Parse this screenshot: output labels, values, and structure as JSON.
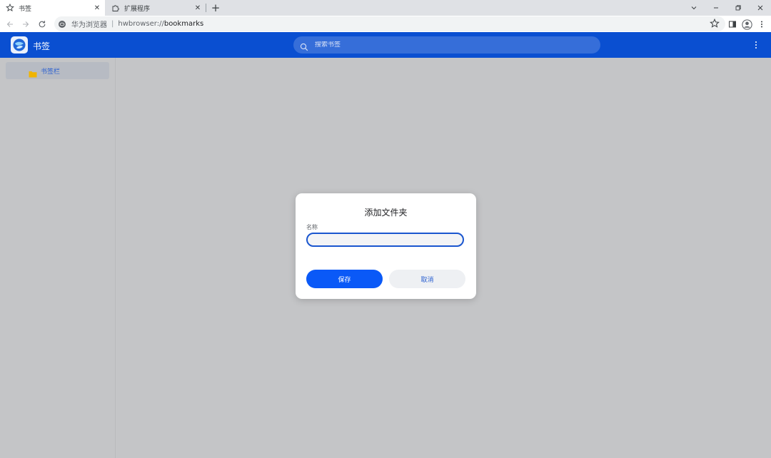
{
  "tabs": [
    {
      "title": "书签",
      "icon": "bookmark-star-icon",
      "active": true
    },
    {
      "title": "扩展程序",
      "icon": "puzzle-icon",
      "active": false
    }
  ],
  "omnibox": {
    "site_name": "华为浏览器",
    "url_scheme": "hwbrowser://",
    "url_host": "bookmarks"
  },
  "header": {
    "title": "书签",
    "search_placeholder": "搜索书签"
  },
  "sidebar": {
    "items": [
      {
        "label": "书签栏",
        "icon": "folder-icon"
      }
    ]
  },
  "dialog": {
    "title": "添加文件夹",
    "name_label": "名称",
    "name_value": "",
    "save_label": "保存",
    "cancel_label": "取消"
  },
  "colors": {
    "header_bg": "#0a4fd1",
    "primary_button": "#0a59f7",
    "folder": "#f0b400",
    "overlay": "#c4c5c7"
  }
}
